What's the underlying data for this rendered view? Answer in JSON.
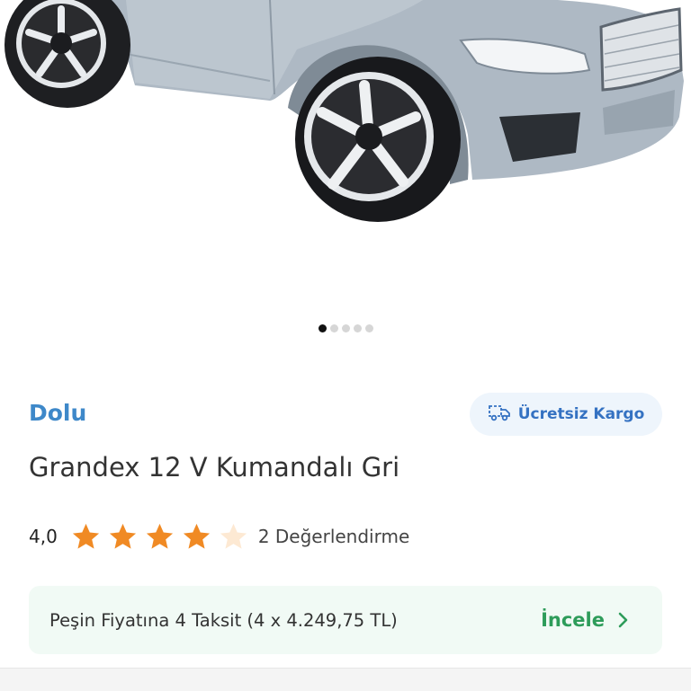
{
  "gallery": {
    "image_alt": "grey ride-on toy car",
    "slide_count": 5,
    "active_slide": 1
  },
  "product": {
    "brand": "Dolu",
    "title": "Grandex 12 V Kumandalı Gri"
  },
  "shipping": {
    "label": "Ücretsiz Kargo",
    "icon": "truck-icon"
  },
  "rating": {
    "value": "4,0",
    "score": 4,
    "max": 5,
    "reviews": "2 Değerlendirme"
  },
  "installment": {
    "text": "Peşin Fiyatına 4 Taksit (4 x 4.249,75 TL)",
    "action_label": "İncele"
  },
  "colors": {
    "brand_blue": "#3e88c9",
    "star_orange": "#f08a24",
    "star_empty": "#fde9d3",
    "green": "#2e9c5a",
    "installment_bg": "#f1faf5"
  }
}
